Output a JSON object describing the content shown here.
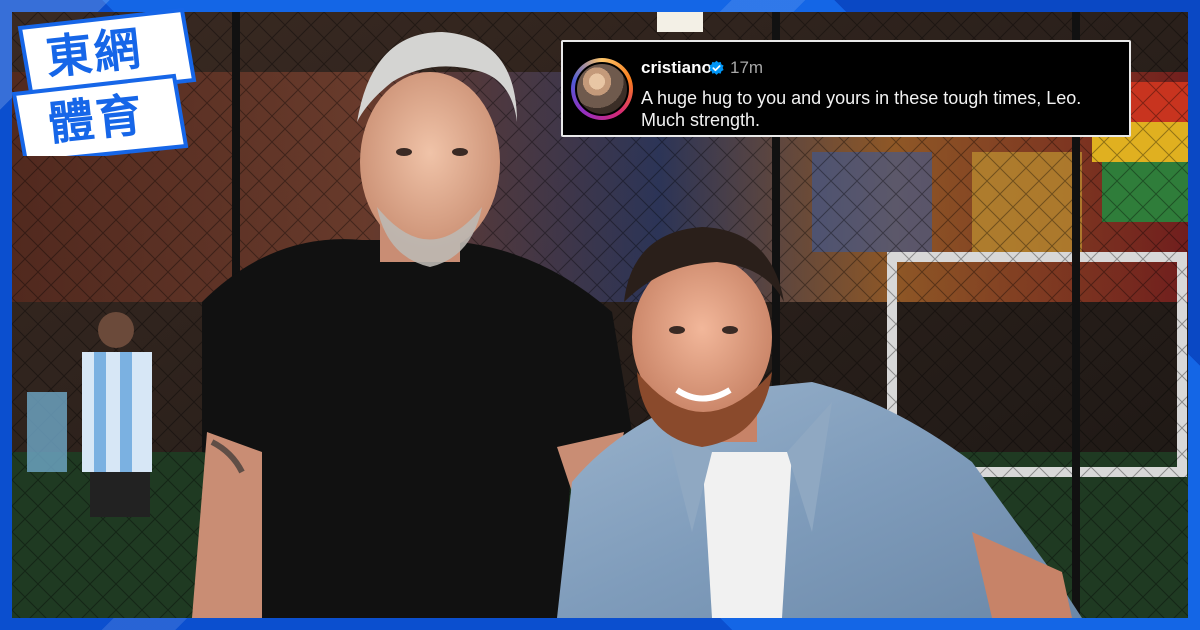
{
  "brand": {
    "logo_line1": "東網",
    "logo_line2": "體育",
    "accent_color": "#1666e8",
    "frame_color": "#0d5bd8"
  },
  "post": {
    "username": "cristiano",
    "verified_icon": "verified-badge-icon",
    "time": "17m",
    "caption": "A huge hug to you and yours in these tough times, Leo. Much strength."
  }
}
